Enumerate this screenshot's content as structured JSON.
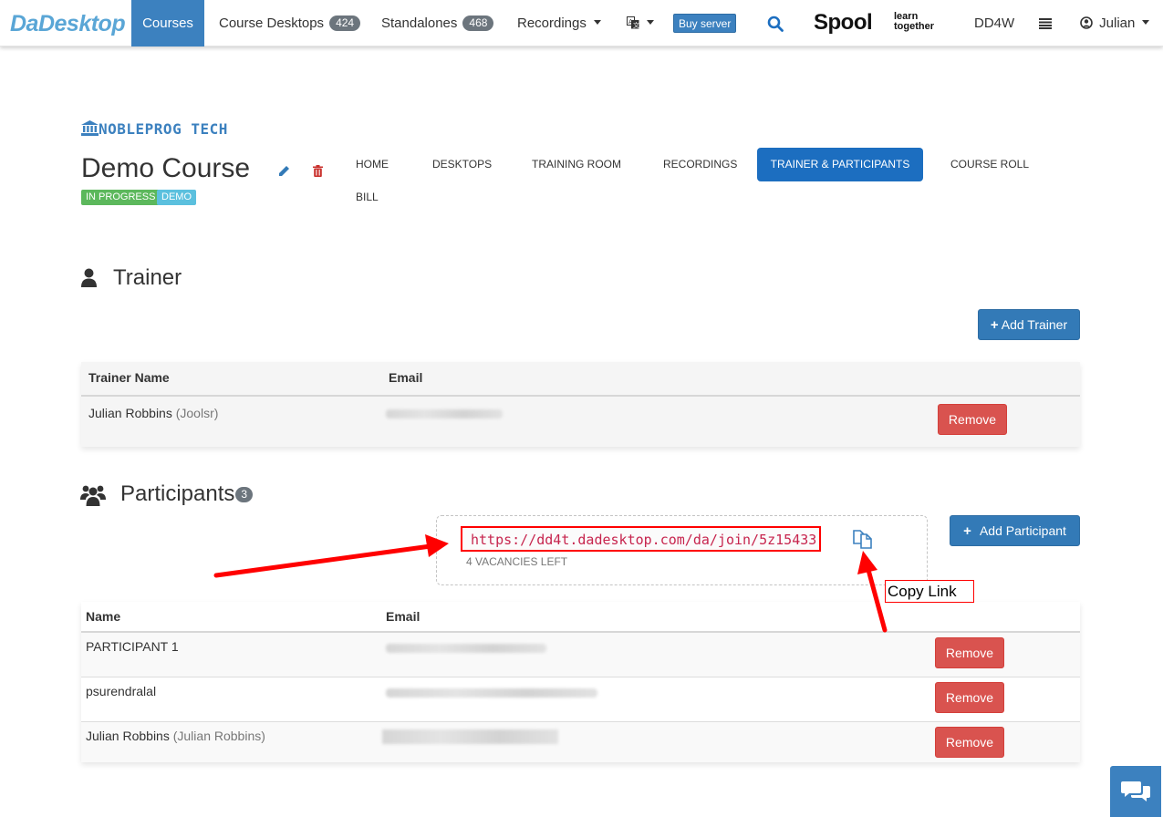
{
  "nav": {
    "brand": "DaDesktop",
    "courses": "Courses",
    "course_desktops": "Course Desktops",
    "course_desktops_count": "424",
    "standalones": "Standalones",
    "standalones_count": "468",
    "recordings": "Recordings",
    "buy_server": "Buy server",
    "spool_word": "Spool",
    "spool_tagline_1": "learn",
    "spool_tagline_2": "together",
    "dd4w": "DD4W",
    "user": "Julian"
  },
  "course": {
    "org": "NOBLEPROG TECH",
    "title": "Demo Course",
    "status_label": "IN PROGRESS",
    "demo_label": "DEMO",
    "tabs": [
      "HOME",
      "DESKTOPS",
      "TRAINING ROOM",
      "RECORDINGS",
      "TRAINER & PARTICIPANTS",
      "COURSE ROLL",
      "BILL"
    ],
    "active_tab": "TRAINER & PARTICIPANTS"
  },
  "trainer": {
    "heading": "Trainer",
    "add_button": "Add Trainer",
    "columns": [
      "Trainer Name",
      "Email"
    ],
    "rows": [
      {
        "name": "Julian Robbins",
        "alias": "(Joolsr)",
        "remove": "Remove"
      }
    ]
  },
  "participants": {
    "heading": "Participants",
    "count": "3",
    "add_button": "Add Participant",
    "join_url": "https://dd4t.dadesktop.com/da/join/5z15433",
    "vacancies": "4 VACANCIES LEFT",
    "copy_annotation": "Copy Link",
    "columns": [
      "Name",
      "Email"
    ],
    "rows": [
      {
        "name": "PARTICIPANT 1",
        "alias": "",
        "remove": "Remove"
      },
      {
        "name": "psurendralal",
        "alias": "",
        "remove": "Remove"
      },
      {
        "name": "Julian Robbins",
        "alias": "(Julian Robbins)",
        "remove": "Remove"
      }
    ]
  },
  "colors": {
    "primary": "#337ab7",
    "nav_active": "#3c81bf",
    "active_tab": "#1c6ec0",
    "success": "#5cb85c",
    "info": "#5bc0de",
    "danger": "#d9534f",
    "annotation": "#ff0000"
  },
  "icons": [
    "search-icon",
    "translate-icon",
    "list-icon",
    "user-circle-icon",
    "bank-icon",
    "pencil-icon",
    "trash-icon",
    "user-icon",
    "users-icon",
    "plus-icon",
    "copy-icon",
    "chat-icon"
  ]
}
